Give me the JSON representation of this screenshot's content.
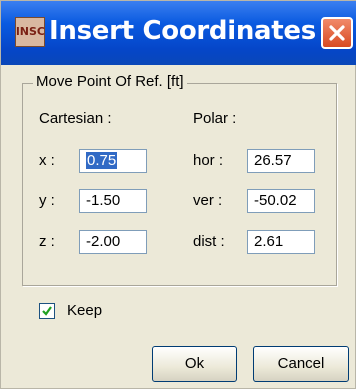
{
  "window": {
    "title": "Insert Coordinates",
    "icon_text": "lNSC"
  },
  "group": {
    "legend": "Move Point Of Ref. [ft]"
  },
  "cartesian": {
    "heading": "Cartesian :",
    "x_label": "x :",
    "y_label": "y :",
    "z_label": "z :",
    "x_value": "0.75",
    "y_value": "-1.50",
    "z_value": "-2.00"
  },
  "polar": {
    "heading": "Polar :",
    "hor_label": "hor :",
    "ver_label": "ver :",
    "dist_label": "dist :",
    "hor_value": "26.57",
    "ver_value": "-50.02",
    "dist_value": "2.61"
  },
  "keep": {
    "label": "Keep",
    "checked": true
  },
  "buttons": {
    "ok": "Ok",
    "cancel": "Cancel"
  },
  "colors": {
    "titlebar": "#0a5ae0",
    "close": "#d84a22",
    "selection": "#316ac5",
    "dialog_bg": "#ece9d8"
  }
}
